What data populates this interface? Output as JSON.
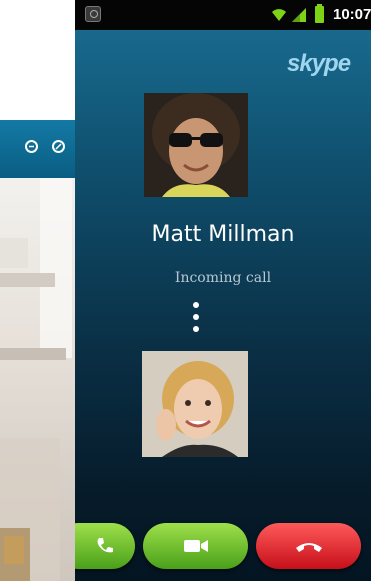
{
  "status_bar": {
    "time": "10:07",
    "battery_color": "#7fd317",
    "icons": [
      "notification-icon",
      "wifi-icon",
      "signal-icon",
      "battery-icon"
    ]
  },
  "app": {
    "logo_text": "skype"
  },
  "call": {
    "caller_name": "Matt Millman",
    "status": "Incoming call"
  },
  "actions": {
    "audio_icon": "phone-icon",
    "video_icon": "video-camera-icon",
    "decline_icon": "hang-up-icon",
    "accept_color": "#5bb31f",
    "decline_color": "#e0151f"
  },
  "window": {
    "controls": [
      "minimize-icon",
      "restore-icon"
    ],
    "accent_color": "#0d6f99"
  }
}
